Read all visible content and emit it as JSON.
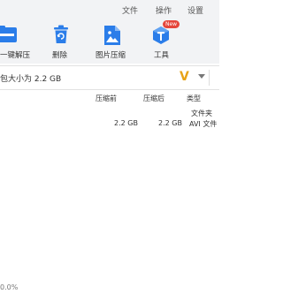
{
  "menu": {
    "file": "文件",
    "operation": "操作",
    "settings": "设置"
  },
  "toolbar": {
    "extract_label": "一键解压",
    "delete_label": "删除",
    "image_compress_label": "图片压缩",
    "tools_label": "工具",
    "new_badge": "New"
  },
  "info": {
    "text": "包大小为 2.2 GB",
    "logo": "V"
  },
  "columns": {
    "before": "压缩前",
    "after": "压缩后",
    "type": "类型"
  },
  "rows": [
    {
      "before": "",
      "after": "",
      "type": "文件夹"
    },
    {
      "before": "2.2 GB",
      "after": "2.2 GB",
      "type": "AVI 文件"
    }
  ],
  "status": "0.0%",
  "colors": {
    "accent": "#2b7de9",
    "logo": "#e8a317",
    "badge": "#e5463b",
    "toolbar_bg": "#f2f3f5"
  }
}
